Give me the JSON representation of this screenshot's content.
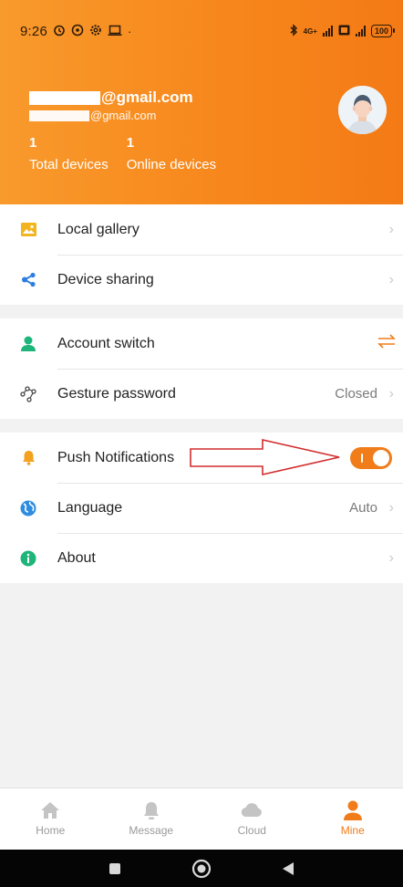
{
  "status_bar": {
    "time": "9:26",
    "icons_left": [
      "alarm-icon",
      "whatsapp-icon",
      "settings-cog-icon",
      "laptop-icon",
      "dot-icon"
    ],
    "icons_right": [
      "bluetooth-icon",
      "network-4g-icon",
      "signal-icon",
      "battery-icon"
    ],
    "network": "4G+",
    "battery": "100"
  },
  "header": {
    "email_primary_suffix": "@gmail.com",
    "email_secondary_suffix": "@gmail.com",
    "stats": [
      {
        "value": "1",
        "label": "Total devices"
      },
      {
        "value": "1",
        "label": "Online devices"
      }
    ],
    "avatar_icon": "user-avatar-icon"
  },
  "menu_groups": [
    [
      {
        "id": "local-gallery",
        "label": "Local gallery",
        "icon": "image-icon",
        "icon_color": "#f2b51f",
        "value": "",
        "control": "chevron"
      },
      {
        "id": "device-sharing",
        "label": "Device sharing",
        "icon": "share-icon",
        "icon_color": "#2f7de1",
        "value": "",
        "control": "chevron"
      }
    ],
    [
      {
        "id": "account-switch",
        "label": "Account switch",
        "icon": "person-icon",
        "icon_color": "#1fb57a",
        "value": "",
        "control": "swap"
      },
      {
        "id": "gesture-password",
        "label": "Gesture password",
        "icon": "gesture-icon",
        "icon_color": "#444444",
        "value": "Closed",
        "control": "chevron"
      }
    ],
    [
      {
        "id": "push-notifications",
        "label": "Push Notifications",
        "icon": "bell-icon",
        "icon_color": "#f2a21f",
        "value": "",
        "control": "toggle",
        "enabled": true
      },
      {
        "id": "language",
        "label": "Language",
        "icon": "globe-icon",
        "icon_color": "#2f8de1",
        "value": "Auto",
        "control": "chevron"
      },
      {
        "id": "about",
        "label": "About",
        "icon": "info-icon",
        "icon_color": "#1fb57a",
        "value": "",
        "control": "chevron"
      }
    ]
  ],
  "bottom_nav": [
    {
      "label": "Home",
      "icon": "home-icon",
      "active": false
    },
    {
      "label": "Message",
      "icon": "bell-icon",
      "active": false
    },
    {
      "label": "Cloud",
      "icon": "cloud-icon",
      "active": false
    },
    {
      "label": "Mine",
      "icon": "person-icon",
      "active": true
    }
  ],
  "system_nav": [
    "recents-square-icon",
    "home-circle-icon",
    "back-triangle-icon"
  ],
  "colors": {
    "accent": "#f07c1a",
    "header_start": "#f99a2c",
    "header_end": "#f47a16",
    "annotation_arrow": "#d22d2d"
  }
}
